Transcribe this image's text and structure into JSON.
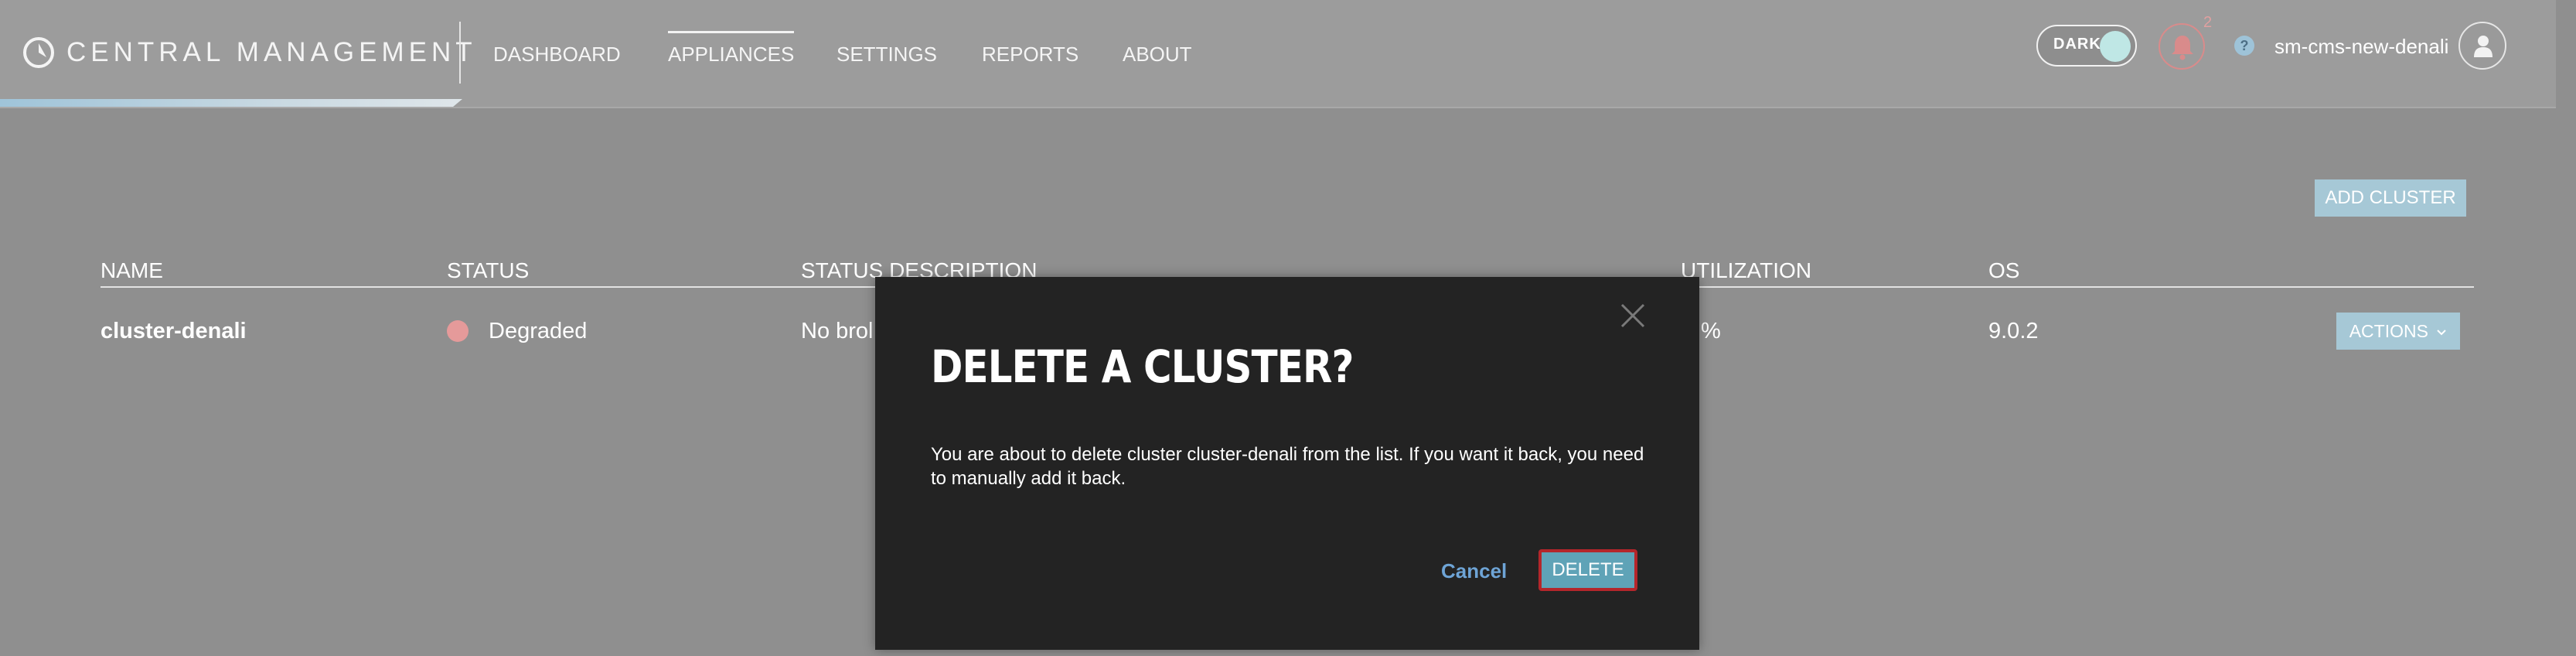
{
  "header": {
    "brand": "CENTRAL MANAGEMENT",
    "nav": [
      {
        "label": "DASHBOARD",
        "active": false
      },
      {
        "label": "APPLIANCES",
        "active": true
      },
      {
        "label": "SETTINGS",
        "active": false
      },
      {
        "label": "REPORTS",
        "active": false
      },
      {
        "label": "ABOUT",
        "active": false
      }
    ],
    "theme_toggle_label": "DARK",
    "notification_count": "2",
    "help_icon": "?",
    "username": "sm-cms-new-denali",
    "icons": {
      "logo": "central-management-logo-icon",
      "bell": "bell-icon",
      "help": "help-icon",
      "avatar": "user-icon"
    }
  },
  "page": {
    "add_cluster_label": "ADD CLUSTER",
    "columns": [
      "NAME",
      "STATUS",
      "STATUS DESCRIPTION",
      "UTILIZATION",
      "OS"
    ],
    "rows": [
      {
        "name": "cluster-denali",
        "status": "Degraded",
        "status_description": "No brol",
        "utilization": "%",
        "os": "9.0.2",
        "actions_label": "ACTIONS"
      }
    ]
  },
  "modal": {
    "title": "DELETE A CLUSTER?",
    "body": "You are about to delete cluster cluster-denali from the list. If you want it back, you need to manually add it back.",
    "cancel_label": "Cancel",
    "delete_label": "DELETE"
  },
  "colors": {
    "overlay_background": "#8f8f8f",
    "accent_button": "#a6c8d6",
    "modal_background": "#232323",
    "delete_button": "#5fa3b7",
    "delete_focus_border": "#b4262b",
    "status_degraded": "#e59a9a",
    "link": "#6ea4d6"
  }
}
